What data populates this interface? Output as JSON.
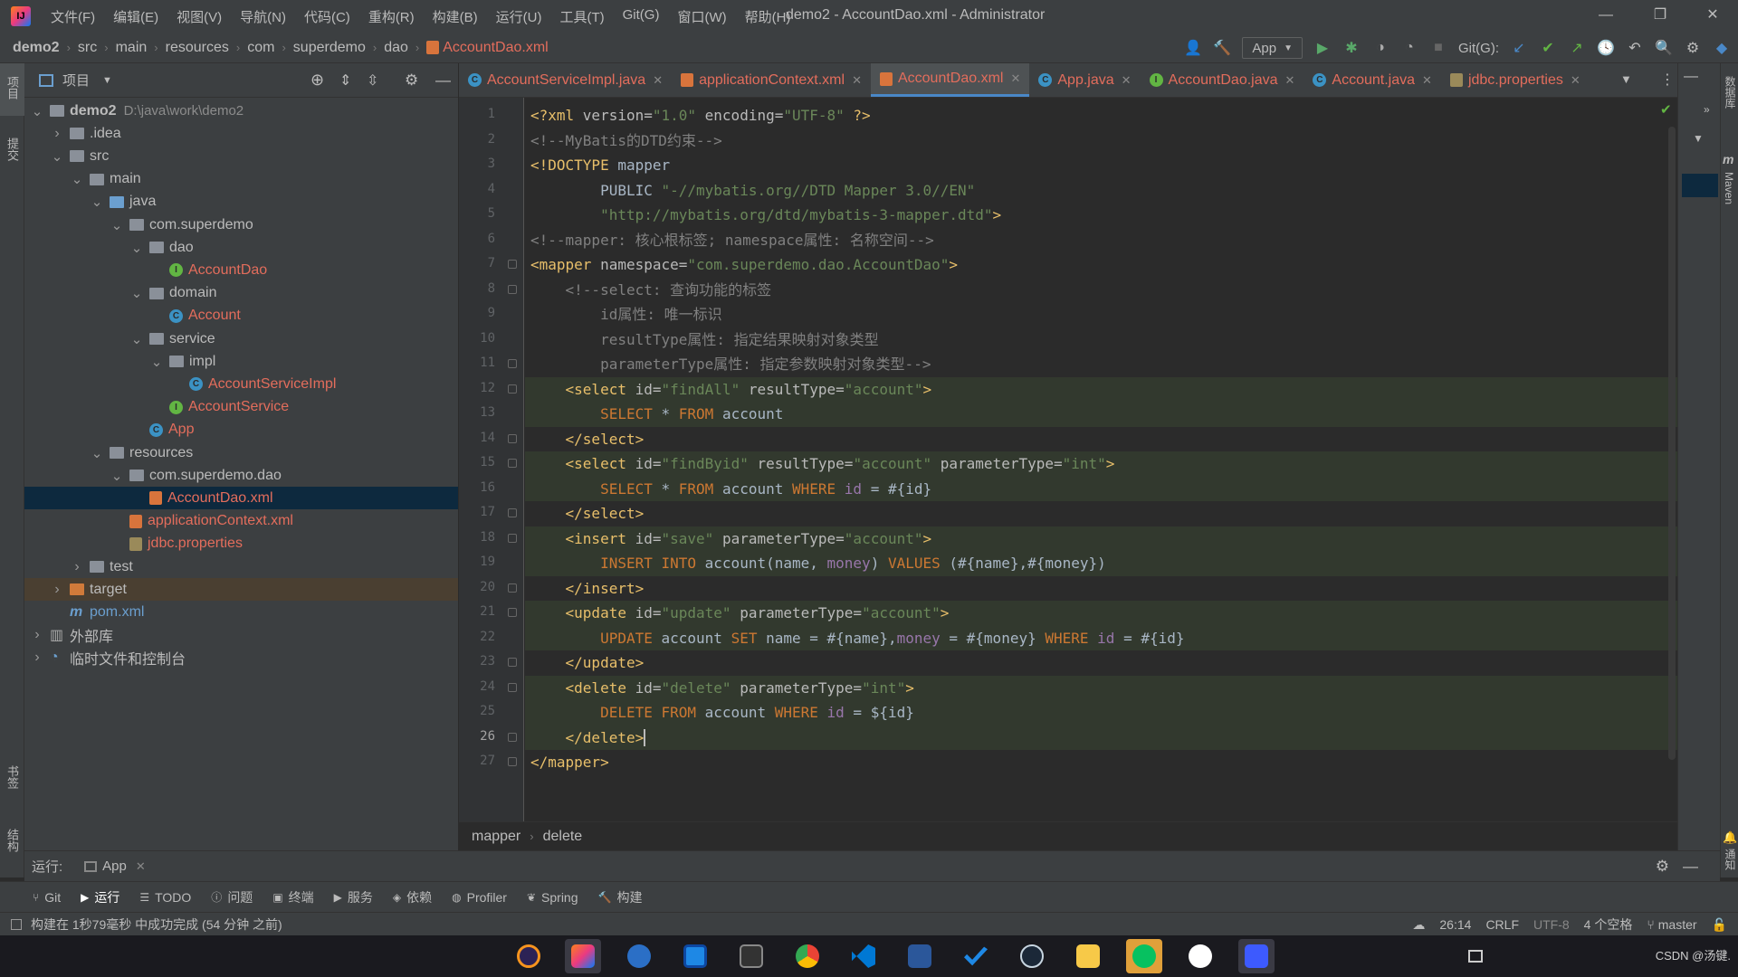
{
  "titlebar": {
    "menu": [
      "文件(F)",
      "编辑(E)",
      "视图(V)",
      "导航(N)",
      "代码(C)",
      "重构(R)",
      "构建(B)",
      "运行(U)",
      "工具(T)",
      "Git(G)",
      "窗口(W)",
      "帮助(H)"
    ],
    "title": "demo2 - AccountDao.xml - Administrator",
    "minimize": "—",
    "restore": "❐",
    "close": "✕"
  },
  "navbar": {
    "breadcrumbs": [
      "demo2",
      "src",
      "main",
      "resources",
      "com",
      "superdemo",
      "dao",
      "AccountDao.xml"
    ],
    "run_config": "App",
    "git_label": "Git(G):"
  },
  "left_stripe": {
    "project": "项目",
    "commit": "提交",
    "bookmarks": "书签",
    "structure": "结构"
  },
  "project_panel": {
    "title": "项目",
    "tree": [
      {
        "label": "demo2",
        "path": "D:\\java\\work\\demo2",
        "indent": 0,
        "arrow": "down",
        "kind": "module"
      },
      {
        "label": ".idea",
        "indent": 1,
        "arrow": "right",
        "kind": "folder"
      },
      {
        "label": "src",
        "indent": 1,
        "arrow": "down",
        "kind": "folder"
      },
      {
        "label": "main",
        "indent": 2,
        "arrow": "down",
        "kind": "folder"
      },
      {
        "label": "java",
        "indent": 3,
        "arrow": "down",
        "kind": "folder-blue"
      },
      {
        "label": "com.superdemo",
        "indent": 4,
        "arrow": "down",
        "kind": "package"
      },
      {
        "label": "dao",
        "indent": 5,
        "arrow": "down",
        "kind": "package"
      },
      {
        "label": "AccountDao",
        "indent": 6,
        "arrow": "",
        "kind": "interface"
      },
      {
        "label": "domain",
        "indent": 5,
        "arrow": "down",
        "kind": "package"
      },
      {
        "label": "Account",
        "indent": 6,
        "arrow": "",
        "kind": "class"
      },
      {
        "label": "service",
        "indent": 5,
        "arrow": "down",
        "kind": "package"
      },
      {
        "label": "impl",
        "indent": 6,
        "arrow": "down",
        "kind": "package"
      },
      {
        "label": "AccountServiceImpl",
        "indent": 7,
        "arrow": "",
        "kind": "class"
      },
      {
        "label": "AccountService",
        "indent": 6,
        "arrow": "",
        "kind": "interface"
      },
      {
        "label": "App",
        "indent": 5,
        "arrow": "",
        "kind": "class"
      },
      {
        "label": "resources",
        "indent": 3,
        "arrow": "down",
        "kind": "folder"
      },
      {
        "label": "com.superdemo.dao",
        "indent": 4,
        "arrow": "down",
        "kind": "package"
      },
      {
        "label": "AccountDao.xml",
        "indent": 5,
        "arrow": "",
        "kind": "xml",
        "selected": true
      },
      {
        "label": "applicationContext.xml",
        "indent": 4,
        "arrow": "",
        "kind": "xml"
      },
      {
        "label": "jdbc.properties",
        "indent": 4,
        "arrow": "",
        "kind": "props"
      },
      {
        "label": "test",
        "indent": 2,
        "arrow": "right",
        "kind": "folder"
      },
      {
        "label": "target",
        "indent": 1,
        "arrow": "right",
        "kind": "folder-orange",
        "excluded": true
      },
      {
        "label": "pom.xml",
        "indent": 1,
        "arrow": "",
        "kind": "maven"
      },
      {
        "label": "外部库",
        "indent": 0,
        "arrow": "right",
        "kind": "lib"
      },
      {
        "label": "临时文件和控制台",
        "indent": 0,
        "arrow": "right",
        "kind": "scratch"
      }
    ]
  },
  "editor": {
    "tabs": [
      {
        "label": "AccountServiceImpl.java",
        "icon": "class-icon",
        "active": false
      },
      {
        "label": "applicationContext.xml",
        "icon": "xml-icon",
        "active": false
      },
      {
        "label": "AccountDao.xml",
        "icon": "xml-icon",
        "active": true
      },
      {
        "label": "App.java",
        "icon": "class-icon",
        "active": false
      },
      {
        "label": "AccountDao.java",
        "icon": "interface-icon",
        "active": false
      },
      {
        "label": "Account.java",
        "icon": "class-icon",
        "active": false
      },
      {
        "label": "jdbc.properties",
        "icon": "properties-icon",
        "active": false
      }
    ],
    "current_line": 26,
    "highlighted_lines": [
      12,
      13,
      15,
      16,
      18,
      19,
      21,
      22,
      24,
      25,
      26
    ],
    "lines": [
      [
        [
          "tag",
          "<?xml "
        ],
        [
          "attr",
          "version="
        ],
        [
          "val",
          "\"1.0\" "
        ],
        [
          "attr",
          "encoding="
        ],
        [
          "val",
          "\"UTF-8\" "
        ],
        [
          "tag",
          "?>"
        ]
      ],
      [
        [
          "cmt",
          "<!--MyBatis的DTD约束-->"
        ]
      ],
      [
        [
          "tag",
          "<!DOCTYPE "
        ],
        [
          "sql",
          "mapper"
        ]
      ],
      [
        [
          "sql",
          "        PUBLIC "
        ],
        [
          "val",
          "\"-//mybatis.org//DTD Mapper 3.0//EN\""
        ]
      ],
      [
        [
          "sql",
          "        "
        ],
        [
          "val",
          "\"http://mybatis.org/dtd/mybatis-3-mapper.dtd\""
        ],
        [
          "tag",
          ">"
        ]
      ],
      [
        [
          "cmt",
          "<!--mapper: 核心根标签; namespace属性: 名称空间-->"
        ]
      ],
      [
        [
          "tag",
          "<mapper "
        ],
        [
          "attr",
          "namespace="
        ],
        [
          "val",
          "\"com.superdemo.dao.AccountDao\""
        ],
        [
          "tag",
          ">"
        ]
      ],
      [
        [
          "cmt",
          "    <!--select: 查询功能的标签"
        ]
      ],
      [
        [
          "cmt",
          "        id属性: 唯一标识"
        ]
      ],
      [
        [
          "cmt",
          "        resultType属性: 指定结果映射对象类型"
        ]
      ],
      [
        [
          "cmt",
          "        parameterType属性: 指定参数映射对象类型-->"
        ]
      ],
      [
        [
          "sql",
          "    "
        ],
        [
          "tag",
          "<select "
        ],
        [
          "attr",
          "id="
        ],
        [
          "val",
          "\"findAll\" "
        ],
        [
          "attr",
          "resultType="
        ],
        [
          "val",
          "\"account\""
        ],
        [
          "tag",
          ">"
        ]
      ],
      [
        [
          "sql",
          "        "
        ],
        [
          "kw",
          "SELECT "
        ],
        [
          "sql",
          "* "
        ],
        [
          "kw",
          "FROM "
        ],
        [
          "sql",
          "account"
        ]
      ],
      [
        [
          "sql",
          "    "
        ],
        [
          "tag",
          "</select>"
        ]
      ],
      [
        [
          "sql",
          "    "
        ],
        [
          "tag",
          "<select "
        ],
        [
          "attr",
          "id="
        ],
        [
          "val",
          "\"findByid\" "
        ],
        [
          "attr",
          "resultType="
        ],
        [
          "val",
          "\"account\" "
        ],
        [
          "attr",
          "parameterType="
        ],
        [
          "val",
          "\"int\""
        ],
        [
          "tag",
          ">"
        ]
      ],
      [
        [
          "sql",
          "        "
        ],
        [
          "kw",
          "SELECT "
        ],
        [
          "sql",
          "* "
        ],
        [
          "kw",
          "FROM "
        ],
        [
          "sql",
          "account "
        ],
        [
          "kw",
          "WHERE "
        ],
        [
          "col",
          "id "
        ],
        [
          "sql",
          "= #{id}"
        ]
      ],
      [
        [
          "sql",
          "    "
        ],
        [
          "tag",
          "</select>"
        ]
      ],
      [
        [
          "sql",
          "    "
        ],
        [
          "tag",
          "<insert "
        ],
        [
          "attr",
          "id="
        ],
        [
          "val",
          "\"save\" "
        ],
        [
          "attr",
          "parameterType="
        ],
        [
          "val",
          "\"account\""
        ],
        [
          "tag",
          ">"
        ]
      ],
      [
        [
          "sql",
          "        "
        ],
        [
          "kw",
          "INSERT INTO "
        ],
        [
          "sql",
          "account(name, "
        ],
        [
          "col",
          "money"
        ],
        [
          "sql",
          ") "
        ],
        [
          "kw",
          "VALUES "
        ],
        [
          "sql",
          "(#{name},#{money})"
        ]
      ],
      [
        [
          "sql",
          "    "
        ],
        [
          "tag",
          "</insert>"
        ]
      ],
      [
        [
          "sql",
          "    "
        ],
        [
          "tag",
          "<update "
        ],
        [
          "attr",
          "id="
        ],
        [
          "val",
          "\"update\" "
        ],
        [
          "attr",
          "parameterType="
        ],
        [
          "val",
          "\"account\""
        ],
        [
          "tag",
          ">"
        ]
      ],
      [
        [
          "sql",
          "        "
        ],
        [
          "kw",
          "UPDATE "
        ],
        [
          "sql",
          "account "
        ],
        [
          "kw",
          "SET "
        ],
        [
          "sql",
          "name = #{name},"
        ],
        [
          "col",
          "money "
        ],
        [
          "sql",
          "= #{money} "
        ],
        [
          "kw",
          "WHERE "
        ],
        [
          "col",
          "id "
        ],
        [
          "sql",
          "= #{id}"
        ]
      ],
      [
        [
          "sql",
          "    "
        ],
        [
          "tag",
          "</update>"
        ]
      ],
      [
        [
          "sql",
          "    "
        ],
        [
          "tag",
          "<delete "
        ],
        [
          "attr",
          "id="
        ],
        [
          "val",
          "\"delete\" "
        ],
        [
          "attr",
          "parameterType="
        ],
        [
          "val",
          "\"int\""
        ],
        [
          "tag",
          ">"
        ]
      ],
      [
        [
          "sql",
          "        "
        ],
        [
          "kw",
          "DELETE FROM "
        ],
        [
          "sql",
          "account "
        ],
        [
          "kw",
          "WHERE "
        ],
        [
          "col",
          "id "
        ],
        [
          "sql",
          "= ${id}"
        ]
      ],
      [
        [
          "sql",
          "    "
        ],
        [
          "tag",
          "</delete>"
        ]
      ],
      [
        [
          "tag",
          "</mapper>"
        ]
      ]
    ],
    "breadcrumb": [
      "mapper",
      "delete"
    ]
  },
  "right_stripe": {
    "database": "数据库",
    "maven": "Maven",
    "notifications": "通知"
  },
  "runbar": {
    "label": "运行:",
    "tab": "App"
  },
  "toolwindows": [
    {
      "label": "Git",
      "icon": "git-icon"
    },
    {
      "label": "运行",
      "icon": "run-icon",
      "active": true
    },
    {
      "label": "TODO",
      "icon": "todo-icon"
    },
    {
      "label": "问题",
      "icon": "problems-icon"
    },
    {
      "label": "终端",
      "icon": "terminal-icon"
    },
    {
      "label": "服务",
      "icon": "services-icon"
    },
    {
      "label": "依赖",
      "icon": "dependencies-icon"
    },
    {
      "label": "Profiler",
      "icon": "profiler-icon"
    },
    {
      "label": "Spring",
      "icon": "spring-icon"
    },
    {
      "label": "构建",
      "icon": "build-icon"
    }
  ],
  "statusbar": {
    "message": "构建在 1秒79毫秒 中成功完成 (54 分钟 之前)",
    "position": "26:14",
    "line_sep": "CRLF",
    "encoding": "UTF-8",
    "indent": "4 个空格",
    "branch": "master"
  },
  "taskbar": {
    "watermark": "CSDN @汤键."
  },
  "colors": {
    "tag": "#e8bf6a",
    "attr": "#bababa",
    "val": "#6a8759",
    "comment": "#808080",
    "keyword": "#cc7832",
    "column": "#9876aa",
    "vcs_modified": "#e36d5c"
  }
}
